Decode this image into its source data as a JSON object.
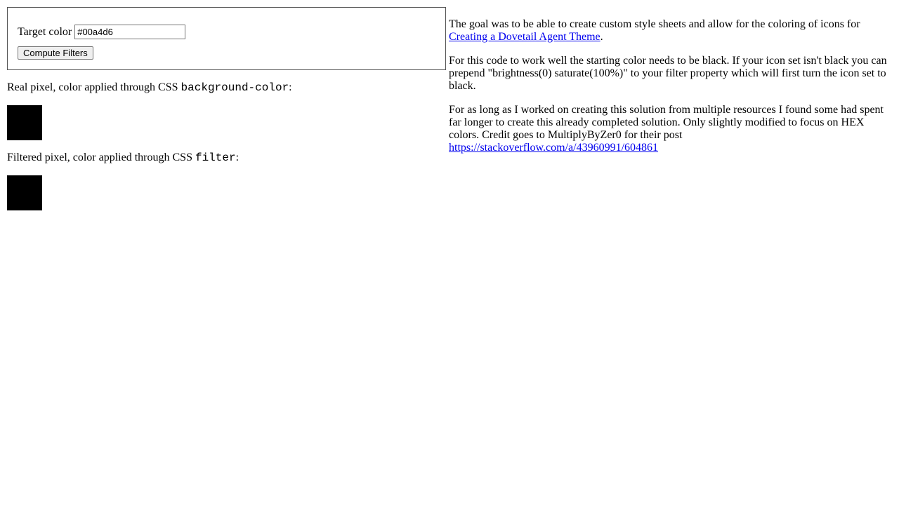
{
  "form": {
    "target_label": "Target color",
    "target_value": "#00a4d6",
    "compute_label": "Compute Filters"
  },
  "left": {
    "real_pixel_prefix": "Real pixel, color applied through CSS ",
    "real_pixel_code": "background-color",
    "real_pixel_suffix": ":",
    "filtered_pixel_prefix": "Filtered pixel, color applied through CSS ",
    "filtered_pixel_code": "filter",
    "filtered_pixel_suffix": ":",
    "swatch_color": "#000000"
  },
  "right": {
    "p1_prefix": "The goal was to be able to create custom style sheets and allow for the coloring of icons for ",
    "p1_link": "Creating a Dovetail Agent Theme",
    "p1_suffix": ".",
    "p2": "For this code to work well the starting color needs to be black. If your icon set isn't black you can prepend \"brightness(0) saturate(100%)\" to your filter property which will first turn the icon set to black.",
    "p3_prefix": "For as long as I worked on creating this solution from multiple resources I found some had spent far longer to create this already completed solution. Only slightly modified to focus on HEX colors. Credit goes to MultiplyByZer0 for their post ",
    "p3_link": "https://stackoverflow.com/a/43960991/604861"
  }
}
